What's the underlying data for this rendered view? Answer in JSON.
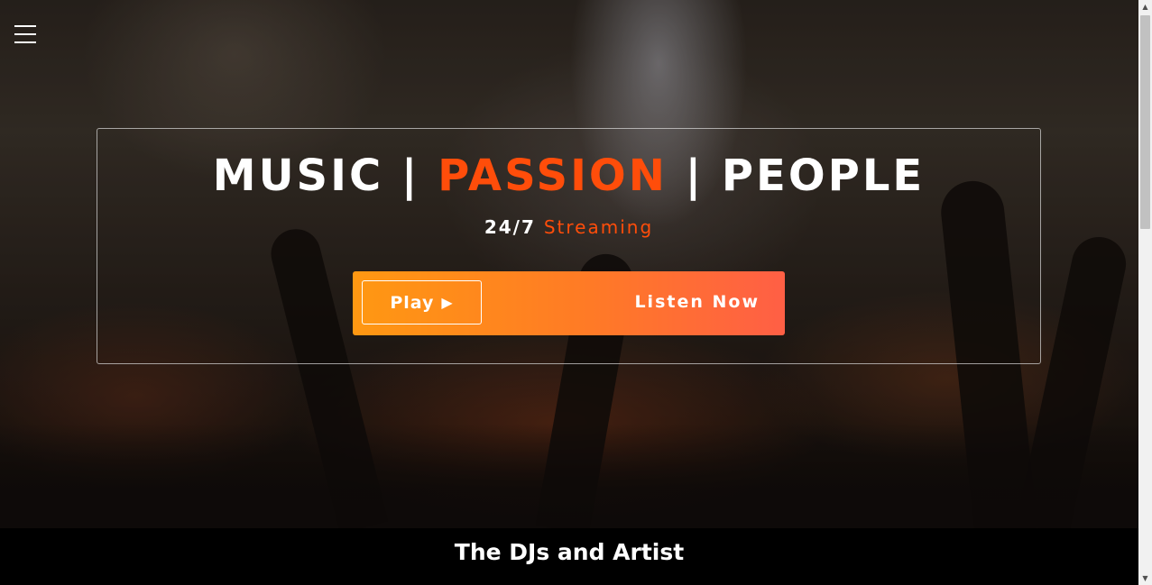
{
  "hero": {
    "headline": {
      "part1": "MUSIC | ",
      "part2": "PASSION",
      "part3": " | PEOPLE"
    },
    "subheadline": {
      "part1": "24/7 ",
      "part2": "Streaming"
    },
    "cta": {
      "play_label": "Play",
      "play_icon": "▶",
      "listen_label": "Listen Now"
    }
  },
  "section": {
    "title": "The DJs and Artist"
  },
  "colors": {
    "accent": "#ff4d0a",
    "cta_gradient_start": "#ff9812",
    "cta_gradient_end": "#ff5f45",
    "footer_bg": "#000000"
  },
  "icons": {
    "menu": "hamburger-menu-icon",
    "play": "play-triangle-icon",
    "scroll_up": "chevron-up-icon",
    "scroll_down": "chevron-down-icon"
  }
}
